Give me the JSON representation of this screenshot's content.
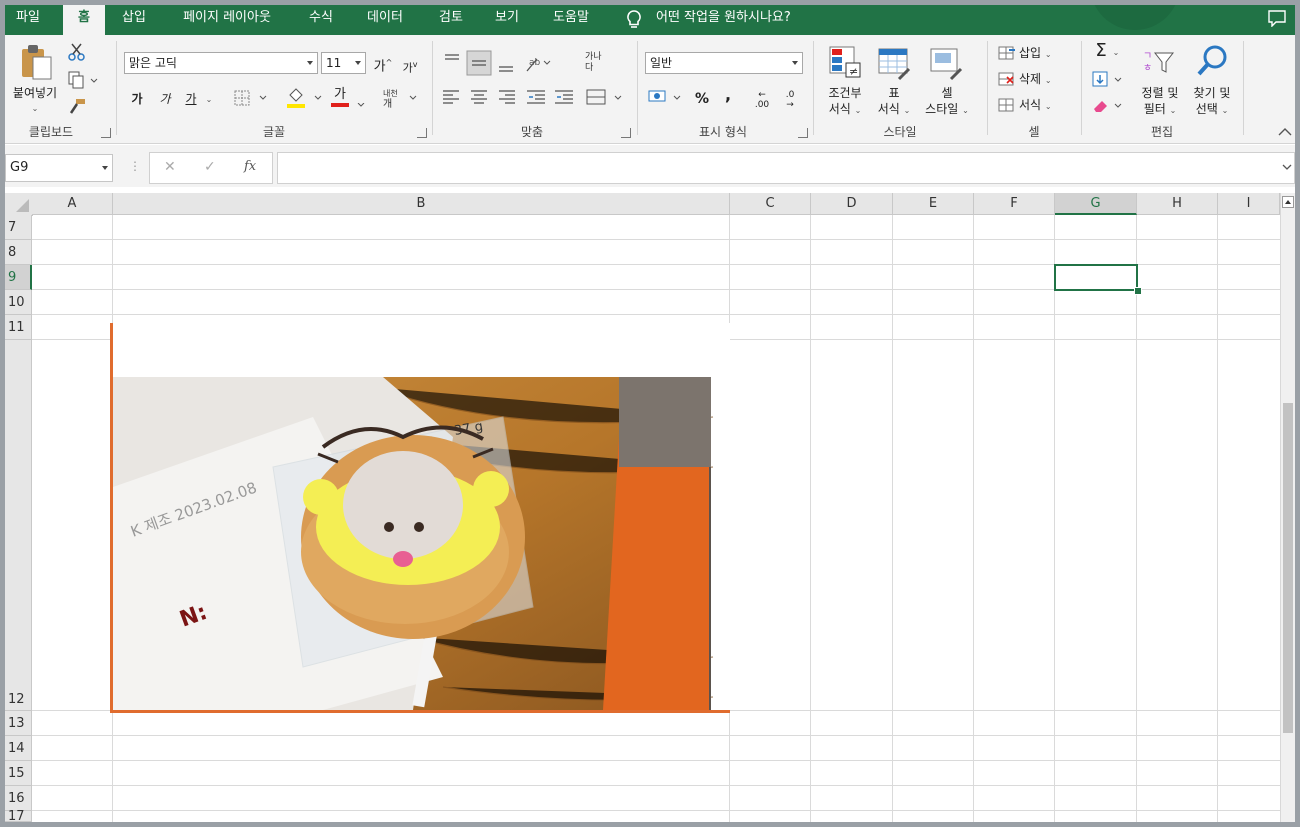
{
  "tabs": [
    {
      "label": "파일",
      "active": false
    },
    {
      "label": "홈",
      "active": true
    },
    {
      "label": "삽입",
      "active": false
    },
    {
      "label": "페이지 레이아웃",
      "active": false
    },
    {
      "label": "수식",
      "active": false
    },
    {
      "label": "데이터",
      "active": false
    },
    {
      "label": "검토",
      "active": false
    },
    {
      "label": "보기",
      "active": false
    },
    {
      "label": "도움말",
      "active": false
    }
  ],
  "tell_me": "어떤 작업을 원하시나요?",
  "ribbon": {
    "clipboard": {
      "paste": "붙여넣기",
      "label": "클립보드"
    },
    "font": {
      "name": "맑은 고딕",
      "size": "11",
      "bold": "가",
      "italic": "가",
      "underline": "가",
      "font_color_glyph": "가",
      "grow_glyph": "가",
      "shrink_glyph": "가",
      "label": "글꼴"
    },
    "alignment": {
      "label": "맞춤"
    },
    "number": {
      "format": "일반",
      "label": "표시 형식",
      "percent": "%",
      "comma": ",",
      "inc_dec": ".00",
      "dec_dec": ".0"
    },
    "styles": {
      "conditional": {
        "line1": "조건부",
        "line2": "서식"
      },
      "table": {
        "line1": "표",
        "line2": "서식"
      },
      "cell": {
        "line1": "셀",
        "line2": "스타일"
      },
      "label": "스타일"
    },
    "cells": {
      "insert": "삽입",
      "delete": "삭제",
      "format": "서식",
      "label": "셀"
    },
    "editing": {
      "sort": {
        "line1": "정렬 및",
        "line2": "필터"
      },
      "find": {
        "line1": "찾기 및",
        "line2": "선택"
      },
      "sigma": "Σ",
      "label": "편집"
    }
  },
  "formula_bar": {
    "name_box": "G9",
    "fx": "fx",
    "cancel": "✕",
    "enter": "✓",
    "formula": ""
  },
  "columns": [
    "A",
    "B",
    "C",
    "D",
    "E",
    "F",
    "G",
    "H",
    "I"
  ],
  "selected_column": "G",
  "rows": [
    "7",
    "8",
    "9",
    "10",
    "11",
    "12",
    "13",
    "14",
    "15",
    "16",
    "17"
  ],
  "selected_row": "9",
  "picture": {
    "stamp_text": "K 제조 2023.02.08",
    "weight_text": "37 g",
    "logo_text": "N:"
  },
  "colors": {
    "excel_green": "#217346",
    "picture_border": "#e06c2e"
  }
}
